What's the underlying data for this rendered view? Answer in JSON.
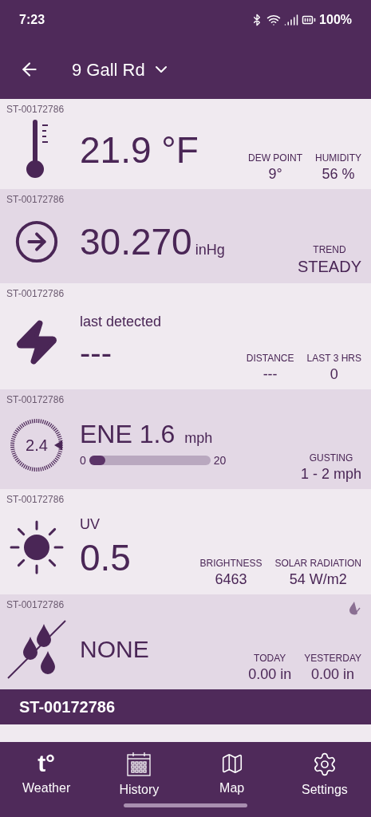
{
  "status_bar": {
    "time": "7:23",
    "battery": "100%"
  },
  "header": {
    "title": "9 Gall Rd"
  },
  "cards": [
    {
      "kind": "temperature",
      "station": "ST-00172786",
      "value": "21.9 °F",
      "stats": [
        {
          "label": "DEW POINT",
          "value": "9°"
        },
        {
          "label": "HUMIDITY",
          "value": "56 %"
        }
      ]
    },
    {
      "kind": "pressure",
      "station": "ST-00172786",
      "value": "30.270",
      "unit": "inHg",
      "stats": [
        {
          "label": "TREND",
          "value": "STEADY"
        }
      ]
    },
    {
      "kind": "lightning",
      "station": "ST-00172786",
      "caption": "last detected",
      "value": "---",
      "stats": [
        {
          "label": "DISTANCE",
          "value": "---"
        },
        {
          "label": "LAST 3 HRS",
          "value": "0"
        }
      ]
    },
    {
      "kind": "wind",
      "station": "ST-00172786",
      "dial": "2.4",
      "value": "ENE 1.6",
      "unit": "mph",
      "scale_min": "0",
      "scale_max": "20",
      "level": 0.08,
      "stats": [
        {
          "label": "GUSTING",
          "value": "1 - 2 mph"
        }
      ]
    },
    {
      "kind": "uv",
      "station": "ST-00172786",
      "caption": "UV",
      "value": "0.5",
      "stats": [
        {
          "label": "BRIGHTNESS",
          "value": "6463"
        },
        {
          "label": "SOLAR RADIATION",
          "value": "54 W/m2"
        }
      ]
    },
    {
      "kind": "rain",
      "station": "ST-00172786",
      "value": "NONE",
      "stats": [
        {
          "label": "TODAY",
          "value": "0.00 in"
        },
        {
          "label": "YESTERDAY",
          "value": "0.00 in"
        }
      ]
    }
  ],
  "station_bar": {
    "title": "ST-00172786"
  },
  "nav": [
    {
      "label": "Weather",
      "glyph": "t°"
    },
    {
      "label": "History"
    },
    {
      "label": "Map"
    },
    {
      "label": "Settings"
    }
  ]
}
